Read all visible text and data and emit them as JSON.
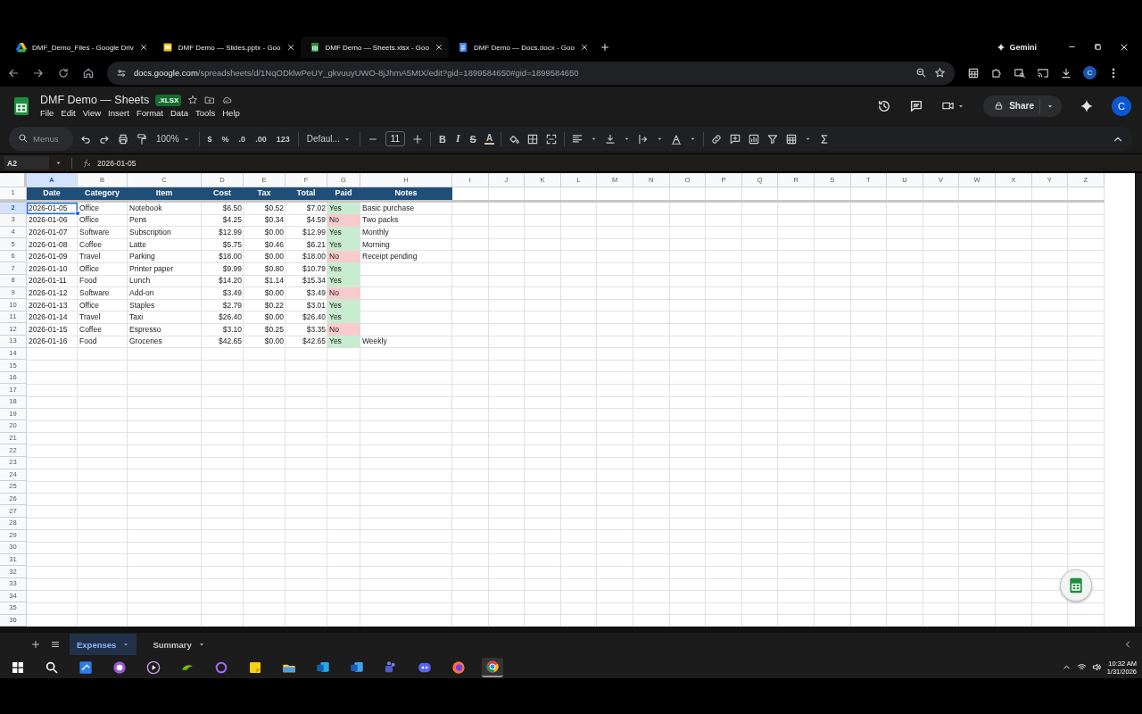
{
  "browser": {
    "tabs": [
      {
        "title": "DMF_Demo_Files - Google Driv",
        "kind": "drive",
        "selected": false
      },
      {
        "title": "DMF Demo — Slides.pptx - Goo",
        "kind": "slides",
        "selected": false
      },
      {
        "title": "DMF Demo — Sheets.xlsx - Goo",
        "kind": "sheets",
        "selected": true
      },
      {
        "title": "DMF Demo — Docs.docx - Goo",
        "kind": "docs",
        "selected": false
      }
    ],
    "gemini": "Gemini",
    "address": {
      "host": "docs.google.com",
      "path": "/spreadsheets/d/1NqODklwPeUY_gkvuuyUWO-8jJhmA5MtX/edit?gid=1899584650#gid=1899584650"
    },
    "avatar": "C"
  },
  "document": {
    "title": "DMF Demo — Sheets",
    "badge": ".XLSX",
    "menus": [
      "File",
      "Edit",
      "View",
      "Insert",
      "Format",
      "Data",
      "Tools",
      "Help"
    ],
    "share": "Share",
    "avatar": "C"
  },
  "toolbar": {
    "search_placeholder": "Menus",
    "zoom": "100%",
    "currency": "$",
    "percent": "%",
    "decrease_decimal": ".0",
    "increase_decimal": ".00",
    "number_format": "123",
    "font": "Defaul...",
    "font_size": "11",
    "bold": "B",
    "italic": "I",
    "strikethrough": "S",
    "text_color": "A"
  },
  "formula_bar": {
    "cell": "A2",
    "value": "2026-01-05"
  },
  "grid": {
    "columns": [
      {
        "label": "A",
        "selected": true
      },
      {
        "label": "B",
        "selected": false
      },
      {
        "label": "C",
        "selected": false
      },
      {
        "label": "D",
        "selected": false
      },
      {
        "label": "E",
        "selected": false
      },
      {
        "label": "F",
        "selected": false
      },
      {
        "label": "G",
        "selected": false
      },
      {
        "label": "H",
        "selected": false
      },
      {
        "label": "I",
        "selected": false
      },
      {
        "label": "J",
        "selected": false
      },
      {
        "label": "K",
        "selected": false
      },
      {
        "label": "L",
        "selected": false
      },
      {
        "label": "M",
        "selected": false
      },
      {
        "label": "N",
        "selected": false
      },
      {
        "label": "O",
        "selected": false
      },
      {
        "label": "P",
        "selected": false
      },
      {
        "label": "Q",
        "selected": false
      },
      {
        "label": "R",
        "selected": false
      },
      {
        "label": "S",
        "selected": false
      },
      {
        "label": "T",
        "selected": false
      },
      {
        "label": "U",
        "selected": false
      },
      {
        "label": "V",
        "selected": false
      },
      {
        "label": "W",
        "selected": false
      },
      {
        "label": "X",
        "selected": false
      },
      {
        "label": "Y",
        "selected": false
      },
      {
        "label": "Z",
        "selected": false
      }
    ],
    "row_numbers": [
      {
        "label": "1",
        "selected": false
      },
      {
        "label": "2",
        "selected": true
      },
      {
        "label": "3",
        "selected": false
      },
      {
        "label": "4",
        "selected": false
      },
      {
        "label": "5",
        "selected": false
      },
      {
        "label": "6",
        "selected": false
      },
      {
        "label": "7",
        "selected": false
      },
      {
        "label": "8",
        "selected": false
      },
      {
        "label": "9",
        "selected": false
      },
      {
        "label": "10",
        "selected": false
      },
      {
        "label": "11",
        "selected": false
      },
      {
        "label": "12",
        "selected": false
      },
      {
        "label": "13",
        "selected": false
      },
      {
        "label": "14",
        "selected": false
      },
      {
        "label": "15",
        "selected": false
      },
      {
        "label": "16",
        "selected": false
      },
      {
        "label": "17",
        "selected": false
      },
      {
        "label": "18",
        "selected": false
      },
      {
        "label": "19",
        "selected": false
      },
      {
        "label": "20",
        "selected": false
      },
      {
        "label": "21",
        "selected": false
      },
      {
        "label": "22",
        "selected": false
      },
      {
        "label": "23",
        "selected": false
      },
      {
        "label": "24",
        "selected": false
      },
      {
        "label": "25",
        "selected": false
      },
      {
        "label": "26",
        "selected": false
      },
      {
        "label": "27",
        "selected": false
      },
      {
        "label": "28",
        "selected": false
      },
      {
        "label": "29",
        "selected": false
      },
      {
        "label": "30",
        "selected": false
      },
      {
        "label": "31",
        "selected": false
      },
      {
        "label": "32",
        "selected": false
      },
      {
        "label": "33",
        "selected": false
      },
      {
        "label": "34",
        "selected": false
      },
      {
        "label": "35",
        "selected": false
      },
      {
        "label": "36",
        "selected": false
      }
    ],
    "header": [
      "Date",
      "Category",
      "Item",
      "Cost",
      "Tax",
      "Total",
      "Paid",
      "Notes"
    ],
    "rows": [
      {
        "cells": [
          "2026-01-05",
          "Office",
          "Notebook",
          "$6.50",
          "$0.52",
          "$7.02",
          "Yes",
          "Basic purchase"
        ],
        "color": "#c9ecd0",
        "selected": true
      },
      {
        "cells": [
          "2026-01-06",
          "Office",
          "Pens",
          "$4.25",
          "$0.34",
          "$4.59",
          "No",
          "Two packs"
        ],
        "color": "#f8cbcf",
        "selected": false
      },
      {
        "cells": [
          "2026-01-07",
          "Software",
          "Subscription",
          "$12.99",
          "$0.00",
          "$12.99",
          "Yes",
          "Monthly"
        ],
        "color": "#c9ecd0",
        "selected": false
      },
      {
        "cells": [
          "2026-01-08",
          "Coffee",
          "Latte",
          "$5.75",
          "$0.46",
          "$6.21",
          "Yes",
          "Morning"
        ],
        "color": "#c9ecd0",
        "selected": false
      },
      {
        "cells": [
          "2026-01-09",
          "Travel",
          "Parking",
          "$18.00",
          "$0.00",
          "$18.00",
          "No",
          "Receipt pending"
        ],
        "color": "#f8cbcf",
        "selected": false
      },
      {
        "cells": [
          "2026-01-10",
          "Office",
          "Printer paper",
          "$9.99",
          "$0.80",
          "$10.79",
          "Yes"
        ],
        "color": "#c9ecd0",
        "selected": false
      },
      {
        "cells": [
          "2026-01-11",
          "Food",
          "Lunch",
          "$14.20",
          "$1.14",
          "$15.34",
          "Yes"
        ],
        "color": "#c9ecd0",
        "selected": false
      },
      {
        "cells": [
          "2026-01-12",
          "Software",
          "Add-on",
          "$3.49",
          "$0.00",
          "$3.49",
          "No"
        ],
        "color": "#f8cbcf",
        "selected": false
      },
      {
        "cells": [
          "2026-01-13",
          "Office",
          "Staples",
          "$2.79",
          "$0.22",
          "$3.01",
          "Yes"
        ],
        "color": "#c9ecd0",
        "selected": false
      },
      {
        "cells": [
          "2026-01-14",
          "Travel",
          "Taxi",
          "$26.40",
          "$0.00",
          "$26.40",
          "Yes"
        ],
        "color": "#c9ecd0",
        "selected": false
      },
      {
        "cells": [
          "2026-01-15",
          "Coffee",
          "Espresso",
          "$3.10",
          "$0.25",
          "$3.35",
          "No"
        ],
        "color": "#f8cbcf",
        "selected": false
      },
      {
        "cells": [
          "2026-01-16",
          "Food",
          "Groceries",
          "$42.65",
          "$0.00",
          "$42.65",
          "Yes",
          "Weekly"
        ],
        "color": "#c9ecd0",
        "selected": false
      }
    ]
  },
  "sheet_tabs": [
    {
      "label": "Expenses",
      "selected": true
    },
    {
      "label": "Summary",
      "selected": false
    }
  ],
  "taskbar": {
    "time": "10:32 AM",
    "date": "1/31/2026"
  }
}
